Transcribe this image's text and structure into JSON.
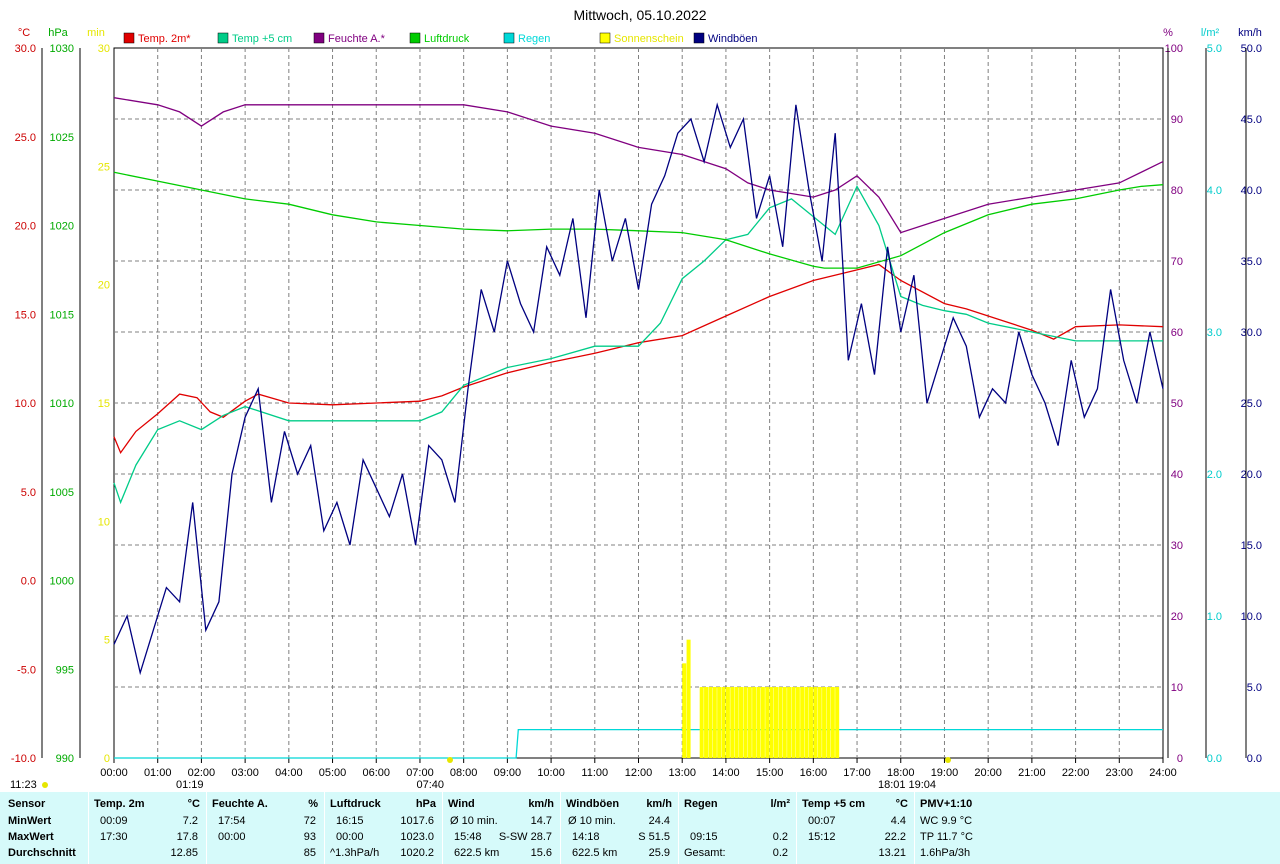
{
  "chart_data": {
    "type": "line",
    "title": "Mittwoch, 05.10.2022",
    "xlabel": "",
    "x_ticks": [
      "00:00",
      "01:00",
      "02:00",
      "03:00",
      "04:00",
      "05:00",
      "06:00",
      "07:00",
      "08:00",
      "09:00",
      "10:00",
      "11:00",
      "12:00",
      "13:00",
      "14:00",
      "15:00",
      "16:00",
      "17:00",
      "18:00",
      "19:00",
      "20:00",
      "21:00",
      "22:00",
      "23:00",
      "24:00"
    ],
    "xlim": [
      0,
      24
    ],
    "grid": true,
    "legend_position": "top",
    "axes": {
      "temp": {
        "unit": "°C",
        "range": [
          -10,
          30
        ],
        "ticks": [
          "-10.0",
          "-5.0",
          "0.0",
          "5.0",
          "10.0",
          "15.0",
          "20.0",
          "25.0",
          "30.0"
        ],
        "color": "#cc0000"
      },
      "pressure": {
        "unit": "hPa",
        "range": [
          990,
          1030
        ],
        "ticks": [
          "990",
          "995",
          "1000",
          "1005",
          "1010",
          "1015",
          "1020",
          "1025",
          "1030"
        ],
        "color": "#00aa00"
      },
      "sun": {
        "unit": "min",
        "range": [
          0,
          30
        ],
        "ticks": [
          "0",
          "5",
          "10",
          "15",
          "20",
          "25",
          "30"
        ],
        "color": "#ffff00"
      },
      "humidity": {
        "unit": "%",
        "range": [
          0,
          100
        ],
        "ticks": [
          "0",
          "10",
          "20",
          "30",
          "40",
          "50",
          "60",
          "70",
          "80",
          "90",
          "100"
        ],
        "color": "#800080"
      },
      "rain": {
        "unit": "l/m²",
        "range": [
          0,
          5
        ],
        "ticks": [
          "0.0",
          "1.0",
          "2.0",
          "3.0",
          "4.0",
          "5.0"
        ],
        "color": "#00cccc"
      },
      "wind": {
        "unit": "km/h",
        "range": [
          0,
          50
        ],
        "ticks": [
          "0.0",
          "5.0",
          "10.0",
          "15.0",
          "20.0",
          "25.0",
          "30.0",
          "35.0",
          "40.0",
          "45.0",
          "50.0"
        ],
        "color": "#000080"
      }
    },
    "series": [
      {
        "name": "Temp. 2m*",
        "color": "#e00000",
        "axis": "temp",
        "x": [
          0,
          0.15,
          0.5,
          1,
          1.5,
          1.9,
          2.2,
          2.5,
          3,
          3.3,
          4,
          5,
          6,
          7,
          7.5,
          8,
          9,
          10,
          11,
          12,
          13,
          14,
          15,
          16,
          17,
          17.5,
          18,
          19,
          19.5,
          20,
          21,
          21.5,
          22,
          23,
          24
        ],
        "y": [
          8.1,
          7.2,
          8.4,
          9.4,
          10.5,
          10.3,
          9.5,
          9.2,
          10.1,
          10.5,
          10.0,
          9.9,
          10.0,
          10.1,
          10.4,
          10.9,
          11.7,
          12.3,
          12.8,
          13.4,
          13.8,
          14.9,
          16.0,
          16.9,
          17.5,
          17.8,
          16.9,
          15.6,
          15.3,
          14.9,
          14.1,
          13.6,
          14.3,
          14.4,
          14.3
        ]
      },
      {
        "name": "Temp +5 cm",
        "color": "#00cc88",
        "axis": "temp",
        "x": [
          0,
          0.15,
          0.5,
          1,
          1.5,
          2,
          2.5,
          3,
          4,
          5,
          6,
          7,
          7.5,
          8,
          9,
          10,
          11,
          12,
          12.5,
          13,
          13.5,
          14,
          14.5,
          15,
          15.5,
          16,
          16.5,
          17,
          17.5,
          18,
          18.5,
          19,
          19.5,
          20,
          21,
          22,
          23,
          24
        ],
        "y": [
          5.5,
          4.4,
          6.5,
          8.5,
          9.0,
          8.5,
          9.3,
          9.8,
          9.0,
          9.0,
          9.0,
          9.0,
          9.5,
          11.0,
          12.0,
          12.5,
          13.2,
          13.2,
          14.5,
          17.0,
          18.0,
          19.2,
          19.5,
          21.0,
          21.5,
          20.5,
          19.5,
          22.2,
          20.0,
          16.0,
          15.5,
          15.2,
          15.0,
          14.5,
          14.0,
          13.5,
          13.5,
          13.5
        ]
      },
      {
        "name": "Feuchte A.*",
        "color": "#800080",
        "axis": "humidity",
        "x": [
          0,
          1,
          1.5,
          2,
          2.5,
          3,
          4,
          5,
          6,
          7,
          8,
          9,
          10,
          11,
          12,
          13,
          14,
          14.5,
          15,
          16,
          16.5,
          17,
          17.5,
          18,
          19,
          20,
          21,
          22,
          23,
          24
        ],
        "y": [
          93,
          92,
          91,
          89,
          91,
          92,
          92,
          92,
          92,
          92,
          92,
          91,
          89,
          88,
          86,
          85,
          83,
          81,
          80,
          79,
          80,
          82,
          79,
          74,
          76,
          78,
          79,
          80,
          81,
          84
        ]
      },
      {
        "name": "Luftdruck",
        "color": "#00cc00",
        "axis": "pressure",
        "x": [
          0,
          1,
          2,
          3,
          4,
          5,
          6,
          7,
          8,
          9,
          10,
          11,
          12,
          13,
          14,
          15,
          16,
          16.25,
          17,
          18,
          19,
          20,
          21,
          22,
          23,
          23.5,
          24
        ],
        "y": [
          1023.0,
          1022.5,
          1022.0,
          1021.5,
          1021.2,
          1020.6,
          1020.2,
          1020.0,
          1019.8,
          1019.7,
          1019.8,
          1019.8,
          1019.7,
          1019.6,
          1019.2,
          1018.4,
          1017.7,
          1017.6,
          1017.6,
          1018.3,
          1019.6,
          1020.6,
          1021.2,
          1021.5,
          1022.0,
          1022.2,
          1022.3
        ]
      },
      {
        "name": "Regen",
        "color": "#00d8d8",
        "axis": "rain",
        "x": [
          0,
          9.2,
          9.25,
          24
        ],
        "y": [
          0,
          0,
          0.2,
          0.2
        ]
      },
      {
        "name": "Sonnenschein",
        "color": "#ffff00",
        "axis": "sun",
        "x": [
          13.0,
          13.1,
          13.4,
          13.5,
          13.6,
          13.7,
          13.8,
          13.9,
          14.0,
          14.1,
          14.2,
          14.3,
          14.4,
          14.5,
          14.6,
          14.7,
          14.8,
          14.9,
          15.0,
          15.1,
          15.2,
          15.3,
          15.4,
          15.5,
          15.6,
          15.7,
          15.8,
          15.9,
          16.0,
          16.1,
          16.2,
          16.3,
          16.4,
          16.5
        ],
        "y": [
          4,
          5,
          3,
          3,
          3,
          3,
          3,
          3,
          3,
          3,
          3,
          3,
          3,
          3,
          3,
          3,
          3,
          3,
          3,
          3,
          3,
          3,
          3,
          3,
          3,
          3,
          3,
          3,
          3,
          3,
          3,
          3,
          3,
          3
        ]
      },
      {
        "name": "Windböen",
        "color": "#000080",
        "axis": "wind",
        "x": [
          0,
          0.3,
          0.6,
          0.9,
          1.2,
          1.5,
          1.8,
          2.1,
          2.4,
          2.7,
          3.0,
          3.3,
          3.6,
          3.9,
          4.2,
          4.5,
          4.8,
          5.1,
          5.4,
          5.7,
          6.0,
          6.3,
          6.6,
          6.9,
          7.2,
          7.5,
          7.8,
          8.1,
          8.4,
          8.7,
          9.0,
          9.3,
          9.6,
          9.9,
          10.2,
          10.5,
          10.8,
          11.1,
          11.4,
          11.7,
          12.0,
          12.3,
          12.6,
          12.9,
          13.2,
          13.5,
          13.8,
          14.1,
          14.4,
          14.7,
          15.0,
          15.3,
          15.6,
          15.9,
          16.2,
          16.5,
          16.8,
          17.1,
          17.4,
          17.7,
          18.0,
          18.3,
          18.6,
          18.9,
          19.2,
          19.5,
          19.8,
          20.1,
          20.4,
          20.7,
          21.0,
          21.3,
          21.6,
          21.9,
          22.2,
          22.5,
          22.8,
          23.1,
          23.4,
          23.7,
          24.0
        ],
        "y": [
          8,
          10,
          6,
          9,
          12,
          11,
          18,
          9,
          11,
          20,
          24,
          26,
          18,
          23,
          20,
          22,
          16,
          18,
          15,
          21,
          19,
          17,
          20,
          15,
          22,
          21,
          18,
          26,
          33,
          30,
          35,
          32,
          30,
          36,
          34,
          38,
          31,
          40,
          35,
          38,
          33,
          39,
          41,
          44,
          45,
          42,
          46,
          43,
          45,
          38,
          41,
          36,
          46,
          40,
          35,
          44,
          28,
          32,
          27,
          36,
          30,
          34,
          25,
          28,
          31,
          29,
          24,
          26,
          25,
          30,
          27,
          25,
          22,
          28,
          24,
          26,
          33,
          28,
          25,
          30,
          26
        ]
      }
    ]
  },
  "stats": {
    "sensor": {
      "header": "Sensor",
      "rows": [
        "MinWert",
        "MaxWert",
        "Durchschnitt"
      ]
    },
    "temp2m": {
      "header": "Temp. 2m",
      "unit": "°C",
      "min_time": "00:09",
      "min_val": "7.2",
      "max_time": "17:30",
      "max_val": "17.8",
      "avg": "12.85"
    },
    "feuchte": {
      "header": "Feuchte A.",
      "unit": "%",
      "min_time": "17:54",
      "min_val": "72",
      "max_time": "00:00",
      "max_val": "93",
      "avg": "85"
    },
    "luftdruck": {
      "header": "Luftdruck",
      "unit": "hPa",
      "min_time": "16:15",
      "min_val": "1017.6",
      "max_time": "00:00",
      "max_val": "1023.0",
      "avg_label": "^1.3hPa/h",
      "avg": "1020.2"
    },
    "wind": {
      "header": "Wind",
      "unit": "km/h",
      "row1_label": "Ø 10 min.",
      "row1_val": "14.7",
      "row2_time": "15:48",
      "row2_dir": "S-SW 28.7",
      "row3_label": "622.5 km",
      "row3_val": "15.6"
    },
    "windboeen": {
      "header": "Windböen",
      "unit": "km/h",
      "row1_label": "Ø 10 min.",
      "row1_val": "24.4",
      "row2_time": "14:18",
      "row2_dir": "S 51.5",
      "row3_label": "622.5 km",
      "row3_val": "25.9"
    },
    "regen": {
      "header": "Regen",
      "unit": "l/m²",
      "row2_time": "09:15",
      "row2_val": "0.2",
      "row3_label": "Gesamt:",
      "row3_val": "0.2"
    },
    "temp5cm": {
      "header": "Temp +5 cm",
      "unit": "°C",
      "min_time": "00:07",
      "min_val": "4.4",
      "max_time": "15:12",
      "max_val": "22.2",
      "avg": "13.21"
    },
    "pmv": {
      "header": "PMV+1:10",
      "row1": "WC 9.9 °C",
      "row2": "TP 11.7 °C",
      "row3": "1.6hPa/3h"
    }
  },
  "markers": {
    "sunrise_label": "07:40",
    "sunset_label": "19:04",
    "moonrise_label": "01:19",
    "moonset_label": "18:01",
    "corner_time": "11:23"
  }
}
